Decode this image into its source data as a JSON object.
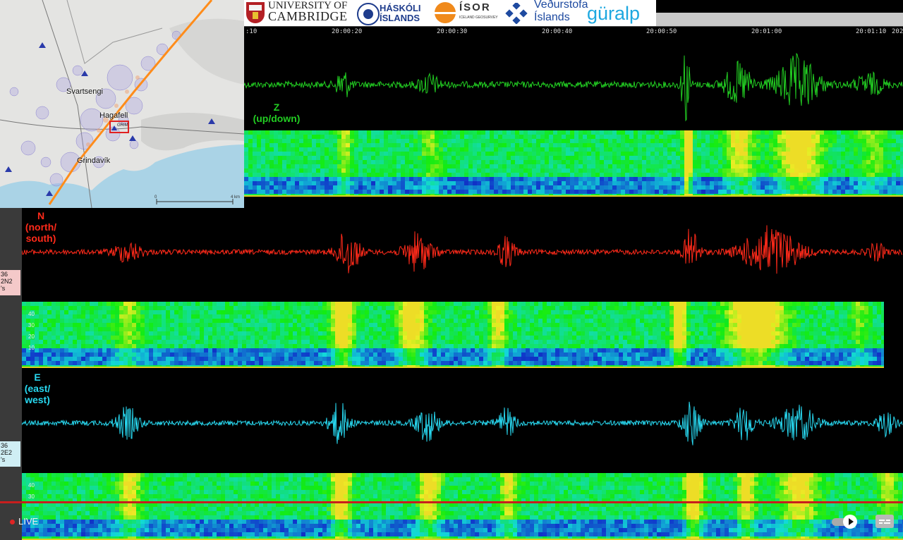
{
  "logos": {
    "cambridge_line1": "UNIVERSITY OF",
    "cambridge_line2": "CAMBRIDGE",
    "hi_line1": "HÁSKÓLI",
    "hi_line2": "ÍSLANDS",
    "isor_name": "ÍSOR",
    "isor_sub": "ICELAND GEOSURVEY",
    "vedur_line1": "Veðurstofa",
    "vedur_line2": "Íslands",
    "guralp": "güralp"
  },
  "map": {
    "places": [
      "Svartsengi",
      "Hagafell",
      "Grindavík"
    ],
    "station_code": "GRIM",
    "scale_start": "0",
    "scale_end": "4 km"
  },
  "timeline": {
    "ticks": [
      ":10",
      "20:00:20",
      "20:00:30",
      "20:00:40",
      "20:00:50",
      "20:01:00",
      "20:01:10",
      "202"
    ]
  },
  "traces": {
    "z": {
      "line1": "Z",
      "line2": "(up/down)",
      "color": "#22cc22"
    },
    "n": {
      "line1": "N",
      "line2": "(north/",
      "line3": "south)",
      "color": "#ff2a1a"
    },
    "e": {
      "line1": "E",
      "line2": "(east/",
      "line3": "west)",
      "color": "#28d8f0"
    }
  },
  "station_labels": {
    "n": [
      "36",
      "2N2",
      "'s"
    ],
    "e": [
      "36",
      "2E2",
      "'s"
    ]
  },
  "freq_ticks": [
    "40",
    "30",
    "20",
    "10"
  ],
  "player": {
    "live_label": "LIVE"
  }
}
